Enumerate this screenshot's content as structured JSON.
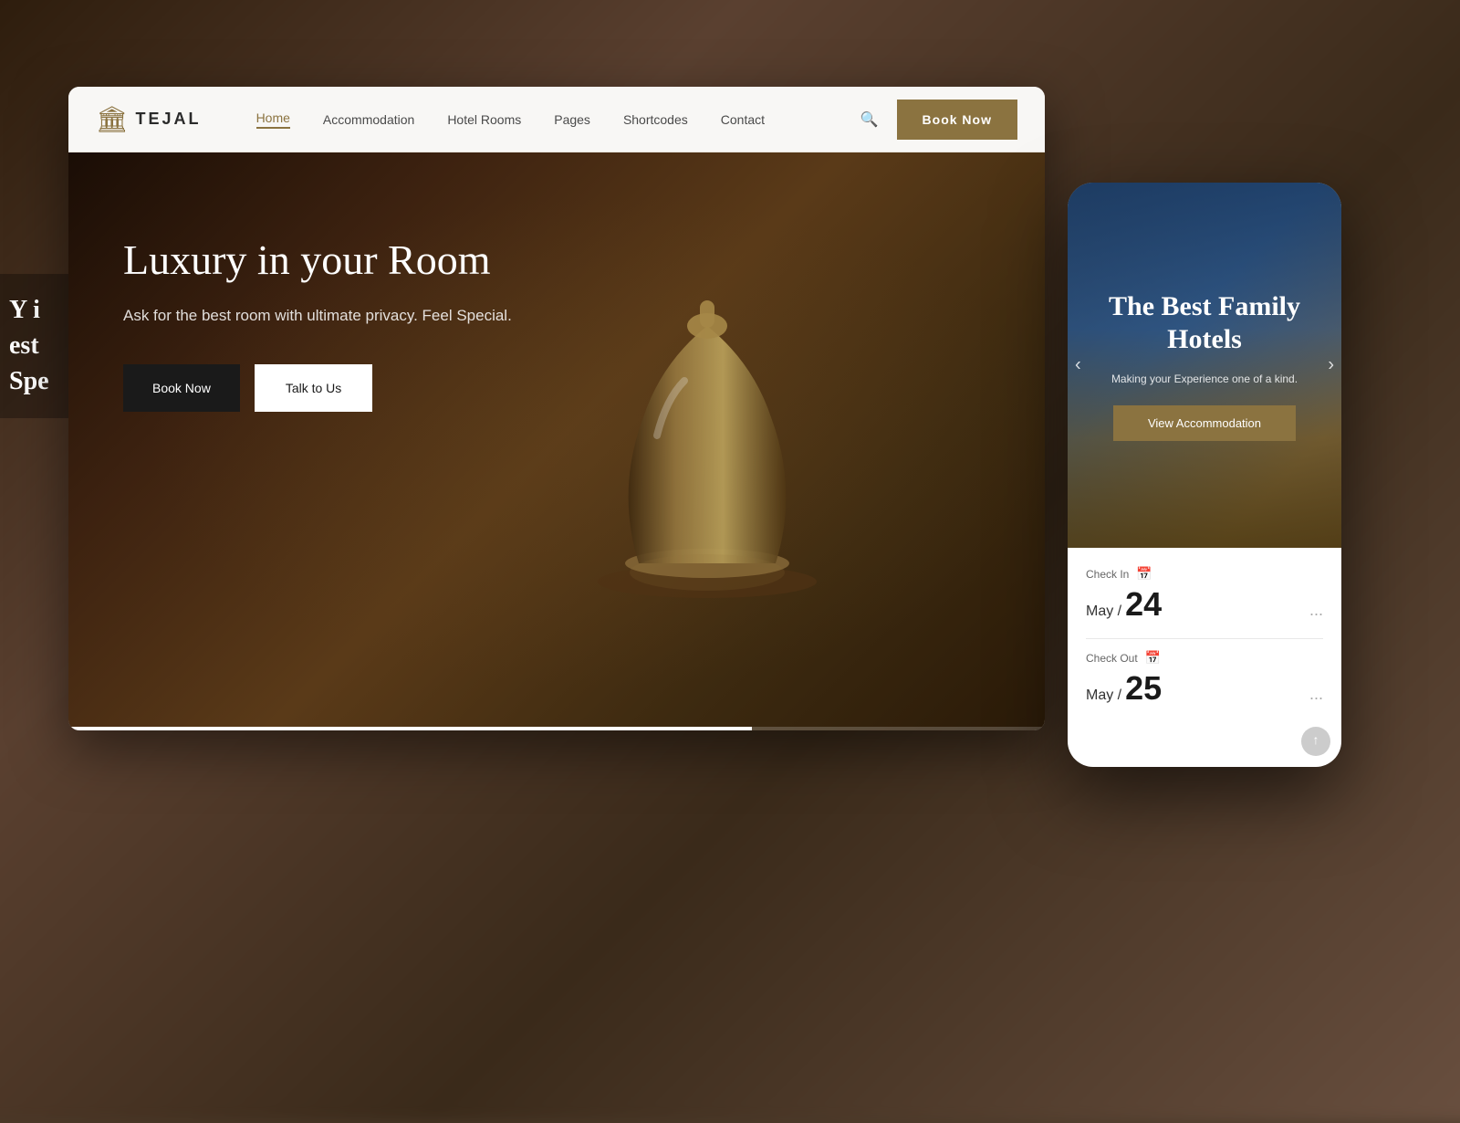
{
  "background": {
    "color": "#4a3a2a"
  },
  "left_edge": {
    "line1": "Y i",
    "line2": "est",
    "line3": "Spe"
  },
  "browser": {
    "navbar": {
      "logo": {
        "icon": "🏛",
        "text": "TEJAL"
      },
      "links": [
        {
          "label": "Home",
          "active": true
        },
        {
          "label": "Accommodation",
          "active": false
        },
        {
          "label": "Hotel Rooms",
          "active": false
        },
        {
          "label": "Pages",
          "active": false
        },
        {
          "label": "Shortcodes",
          "active": false
        },
        {
          "label": "Contact",
          "active": false
        }
      ],
      "book_now": "Book Now"
    },
    "hero": {
      "title": "Luxury in your Room",
      "subtitle": "Ask for the best room with ultimate privacy. Feel Special.",
      "btn_book": "Book Now",
      "btn_talk": "Talk to Us"
    }
  },
  "phone": {
    "hero": {
      "title": "The Best Family Hotels",
      "subtitle": "Making your Experience one of a kind.",
      "view_btn": "View Accommodation",
      "prev_icon": "‹",
      "next_icon": "›"
    },
    "booking": {
      "checkin": {
        "label": "Check In",
        "month": "May /",
        "day": "24",
        "dots": "..."
      },
      "checkout": {
        "label": "Check Out",
        "month": "May /",
        "day": "25",
        "dots": "..."
      }
    },
    "scroll_icon": "↑"
  }
}
